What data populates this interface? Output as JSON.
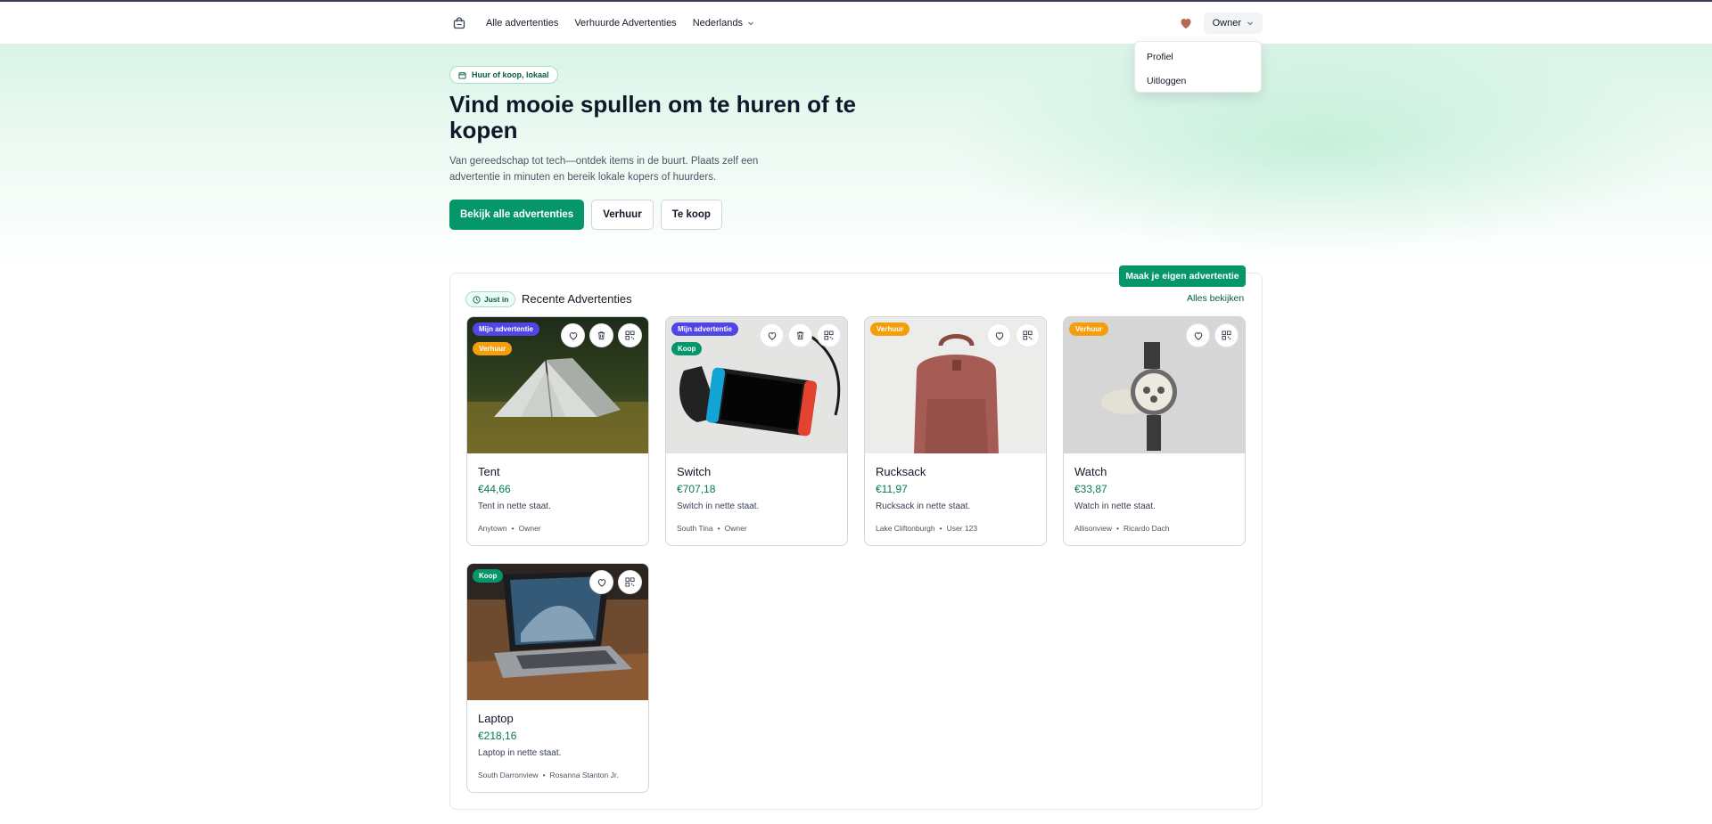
{
  "nav": {
    "links": [
      "Alle advertenties",
      "Verhuurde Advertenties"
    ],
    "language": "Nederlands",
    "user": "Owner",
    "icons": {
      "logo": "shopping-bag-icon",
      "favorites": "heart-icon",
      "chevron": "chevron-down-icon"
    }
  },
  "user_menu": {
    "items": [
      "Profiel",
      "Uitloggen"
    ]
  },
  "hero": {
    "pill": "Huur of koop, lokaal",
    "title": "Vind mooie spullen om te huren of te kopen",
    "lead": "Van gereedschap tot tech—ontdek items in de buurt. Plaats zelf een advertentie in minuten en bereik lokale kopers of huurders.",
    "buttons": {
      "primary": "Bekijk alle advertenties",
      "rent": "Verhuur",
      "buy": "Te koop"
    }
  },
  "recent": {
    "badge": "Just in",
    "title": "Recente Advertenties",
    "create_button": "Maak je eigen advertentie",
    "see_all": "Alles bekijken"
  },
  "listings": [
    {
      "title": "Tent",
      "price": "€44,66",
      "desc": "Tent in nette staat.",
      "location": "Anytown",
      "owner": "Owner",
      "badges": [
        "Mijn advertentie",
        "Verhuur"
      ],
      "mine": true
    },
    {
      "title": "Switch",
      "price": "€707,18",
      "desc": "Switch in nette staat.",
      "location": "South Tina",
      "owner": "Owner",
      "badges": [
        "Mijn advertentie",
        "Koop"
      ],
      "mine": true
    },
    {
      "title": "Rucksack",
      "price": "€11,97",
      "desc": "Rucksack in nette staat.",
      "location": "Lake Cliftonburgh",
      "owner": "User 123",
      "badges": [
        "Verhuur"
      ],
      "mine": false
    },
    {
      "title": "Watch",
      "price": "€33,87",
      "desc": "Watch in nette staat.",
      "location": "Allisonview",
      "owner": "Ricardo Dach",
      "badges": [
        "Verhuur"
      ],
      "mine": false
    },
    {
      "title": "Laptop",
      "price": "€218,16",
      "desc": "Laptop in nette staat.",
      "location": "South Darronview",
      "owner": "Rosanna Stanton Jr.",
      "badges": [
        "Koop"
      ],
      "mine": false
    }
  ],
  "colors": {
    "accent": "#059669",
    "badge_mine": "#4f46e5",
    "badge_rent": "#f59e0b",
    "badge_buy": "#059669",
    "favorites_heart": "#b46a55"
  }
}
